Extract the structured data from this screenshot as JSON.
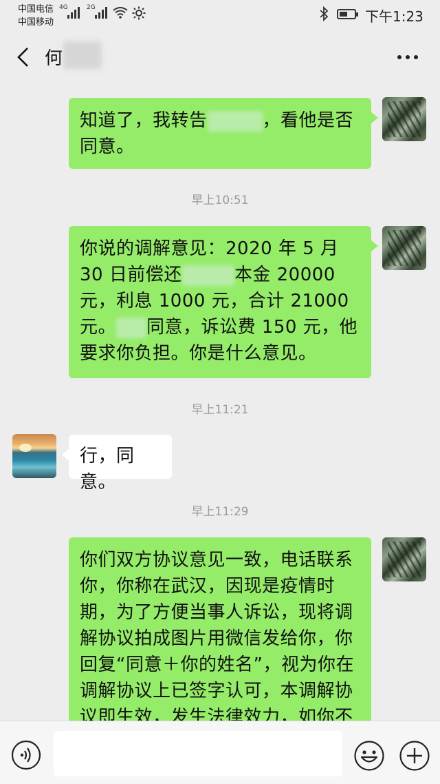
{
  "status_bar": {
    "carrier_1": "中国电信",
    "carrier_2": "中国移动",
    "network_1": "4G",
    "network_2": "2G",
    "battery_level": 0.55,
    "time": "下午1:23"
  },
  "header": {
    "contact_name": "何"
  },
  "messages": [
    {
      "sender": "me",
      "text_parts": [
        "知道了，我转告",
        "，看他是否同意。"
      ]
    },
    {
      "type": "time",
      "text": "早上10:51"
    },
    {
      "sender": "me",
      "text_parts": [
        "你说的调解意见：2020 年 5 月 30 日前偿还",
        "本金 20000 元，利息 1000 元，合计 21000 元。",
        "同意，诉讼费 150 元，他要求你负担。你是什么意见。"
      ]
    },
    {
      "type": "time",
      "text": "早上11:21"
    },
    {
      "sender": "other",
      "text": "行，同意。"
    },
    {
      "type": "time",
      "text": "早上11:29"
    },
    {
      "sender": "me",
      "text": "你们双方协议意见一致，电话联系你，你称在武汉，因现是疫情时期，为了方便当事人诉讼，现将调解协议拍成图片用微信发给你，你回复“同意＋你的姓名”，视为你在调解协议上已签字认可，本调解协议即生效，发生法律效力，如你不按期履"
    }
  ],
  "icons": {
    "back": "chevron-left-icon",
    "more": "more-dots-icon",
    "voice": "voice-icon",
    "emoji": "emoji-icon",
    "plus": "plus-icon",
    "wifi": "wifi-icon",
    "bluetooth": "bluetooth-icon",
    "battery": "battery-icon"
  },
  "colors": {
    "my_bubble": "#95ec69",
    "other_bubble": "#ffffff",
    "background": "#ededed"
  }
}
